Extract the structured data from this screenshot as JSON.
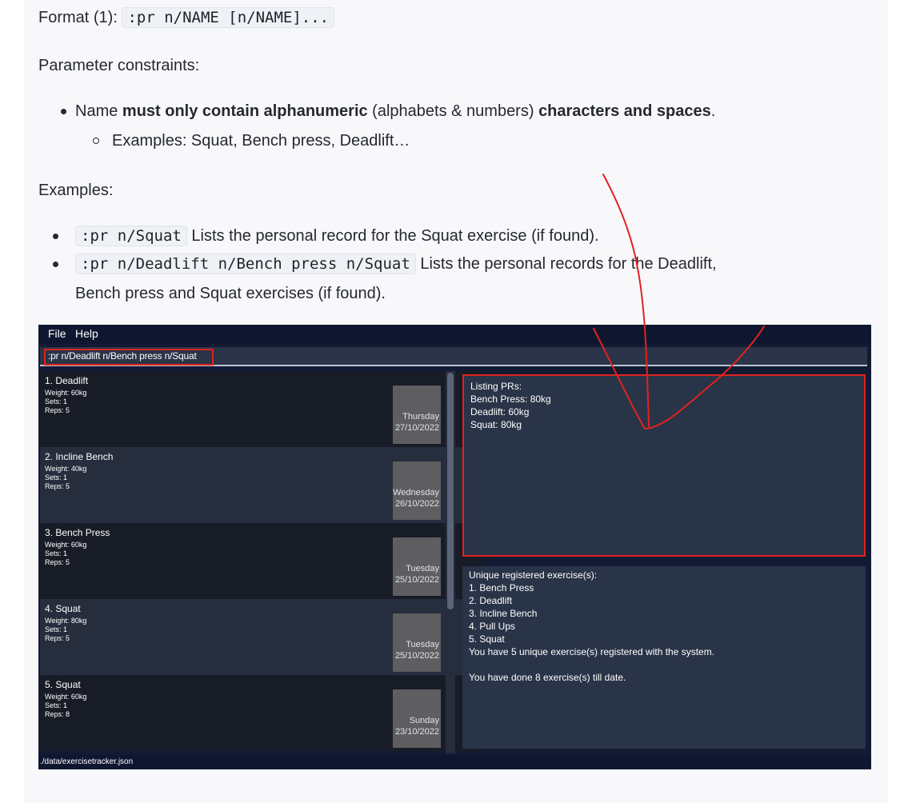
{
  "doc": {
    "format_label": "Format (1):",
    "format_code": ":pr n/NAME [n/NAME]...",
    "constraints_heading": "Parameter constraints:",
    "constraint": {
      "prefix": "Name ",
      "bold1": "must only contain alphanumeric",
      "middle": " (alphabets & numbers) ",
      "bold2": "characters and spaces",
      "suffix": "."
    },
    "constraint_sub": "Examples: Squat, Bench press, Deadlift…",
    "examples_heading": "Examples:",
    "examples": [
      {
        "code": ":pr n/Squat",
        "text": " Lists the personal record for the Squat exercise (if found)."
      },
      {
        "code": ":pr n/Deadlift n/Bench press n/Squat",
        "text": " Lists the personal records for the Deadlift,",
        "text_line2": "Bench press and Squat exercises (if found)."
      }
    ]
  },
  "app": {
    "menu": [
      "File",
      "Help"
    ],
    "command_input": ":pr n/Deadlift n/Bench press n/Squat",
    "exercises": [
      {
        "title": "1.  Deadlift",
        "weight": "Weight: 60kg",
        "sets": "Sets: 1",
        "reps": "Reps: 5",
        "day": "Thursday",
        "date": "27/10/2022"
      },
      {
        "title": "2.  Incline Bench",
        "weight": "Weight: 40kg",
        "sets": "Sets: 1",
        "reps": "Reps: 5",
        "day": "Wednesday",
        "date": "26/10/2022"
      },
      {
        "title": "3.  Bench Press",
        "weight": "Weight: 60kg",
        "sets": "Sets: 1",
        "reps": "Reps: 5",
        "day": "Tuesday",
        "date": "25/10/2022"
      },
      {
        "title": "4.  Squat",
        "weight": "Weight: 80kg",
        "sets": "Sets: 1",
        "reps": "Reps: 5",
        "day": "Tuesday",
        "date": "25/10/2022"
      },
      {
        "title": "5.  Squat",
        "weight": "Weight: 60kg",
        "sets": "Sets: 1",
        "reps": "Reps: 8",
        "day": "Sunday",
        "date": "23/10/2022"
      }
    ],
    "result_lines": [
      "Listing PRs:",
      "Bench Press: 80kg",
      "Deadlift: 60kg",
      "Squat: 80kg"
    ],
    "summary_lines": [
      "Unique registered exercise(s):",
      "1. Bench Press",
      "2. Deadlift",
      "3. Incline Bench",
      "4. Pull Ups",
      "5. Squat",
      "You have 5 unique exercise(s) registered with the system.",
      "",
      "You have done 8 exercise(s) till date."
    ],
    "status_path": "./data/exercisetracker.json"
  },
  "colors": {
    "annotation": "#e2221f",
    "app_background": "#121b33",
    "card_dark": "#181c26",
    "card_light": "#262d3d",
    "panel": "#2a3448"
  }
}
